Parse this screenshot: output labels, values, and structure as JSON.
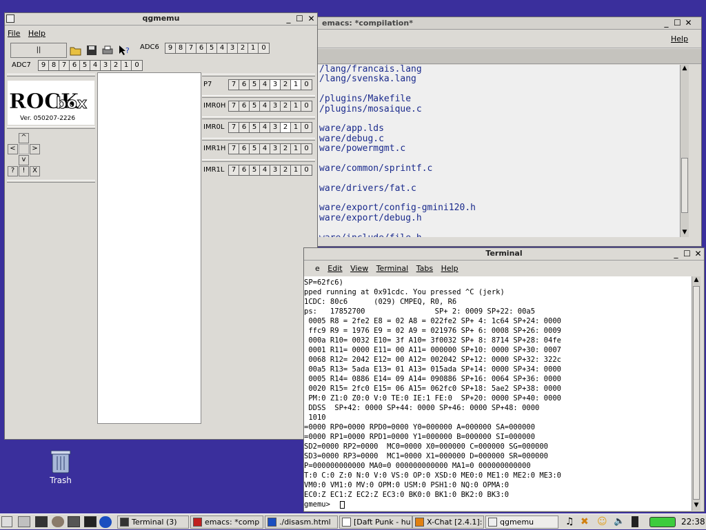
{
  "qgmemu": {
    "title": "qgmemu",
    "menu": [
      "File",
      "Help"
    ],
    "pause_label": "||",
    "adc6_label": "ADC6",
    "adc7_label": "ADC7",
    "adc_bits": [
      "9",
      "8",
      "7",
      "6",
      "5",
      "4",
      "3",
      "2",
      "1",
      "0"
    ],
    "port_bits": [
      "7",
      "6",
      "5",
      "4",
      "3",
      "2",
      "1",
      "0"
    ],
    "ports": [
      "P7",
      "IMR0H",
      "IMR0L",
      "IMR1H",
      "IMR1L"
    ],
    "logo_text": "ROCK",
    "logo_text2": "box",
    "version": "Ver. 050207-2226",
    "dpad": {
      "up": "^",
      "left": "<",
      "right": ">",
      "down": "v",
      "q": "?",
      "bang": "!",
      "x": "X"
    }
  },
  "emacs": {
    "title": "emacs: *compilation*",
    "help": "Help",
    "lines": [
      "/lang/francais.lang",
      "/lang/svenska.lang",
      "",
      "/plugins/Makefile",
      "/plugins/mosaique.c",
      "",
      "ware/app.lds",
      "ware/debug.c",
      "ware/powermgmt.c",
      "",
      "ware/common/sprintf.c",
      "",
      "ware/drivers/fat.c",
      "",
      "ware/export/config-gmini120.h",
      "ware/export/debug.h",
      "",
      "ware/include/file.h"
    ]
  },
  "terminal": {
    "title": "Terminal",
    "menu": [
      "e",
      "Edit",
      "View",
      "Terminal",
      "Tabs",
      "Help"
    ],
    "lines": [
      "SP=62fc6)",
      "pped running at 0x91cdc. You pressed ^C (jerk)",
      "1CDC: 80c6      (029) CMPEQ, R0, R6",
      "ps:   17852700                SP+ 2: 0009 SP+22: 00a5",
      " 0005 R8 = 2fe2 E8 = 02 A8 = 022fe2 SP+ 4: 1c64 SP+24: 0000",
      " ffc9 R9 = 1976 E9 = 02 A9 = 021976 SP+ 6: 0008 SP+26: 0009",
      " 000a R10= 0032 E10= 3f A10= 3f0032 SP+ 8: 8714 SP+28: 04fe",
      " 0001 R11= 0000 E11= 00 A11= 000000 SP+10: 0000 SP+30: 0007",
      " 0068 R12= 2042 E12= 00 A12= 002042 SP+12: 0000 SP+32: 322c",
      " 00a5 R13= 5ada E13= 01 A13= 015ada SP+14: 0000 SP+34: 0000",
      " 0005 R14= 0886 E14= 09 A14= 090886 SP+16: 0064 SP+36: 0000",
      " 0020 R15= 2fc0 E15= 06 A15= 062fc0 SP+18: 5ae2 SP+38: 0000",
      " PM:0 Z1:0 Z0:0 V:0 TE:0 IE:1 FE:0  SP+20: 0000 SP+40: 0000",
      " DDSS  SP+42: 0000 SP+44: 0000 SP+46: 0000 SP+48: 0000",
      " 1010",
      "=0000 RP0=0000 RPD0=0000 Y0=000000 A=000000 SA=000000",
      "=0000 RP1=0000 RPD1=0000 Y1=000000 B=000000 SI=000000",
      "SD2=0000 RP2=0000  MC0=0000 X0=000000 C=000000 SG=000000",
      "SD3=0000 RP3=0000  MC1=0000 X1=000000 D=000000 SR=000000",
      "P=000000000000 MA0=0 000000000000 MA1=0 000000000000",
      "T:0 C:0 Z:0 N:0 V:0 VS:0 OP:0 XSD:0 ME0:0 ME1:0 ME2:0 ME3:0",
      "VM0:0 VM1:0 MV:0 OPM:0 USM:0 PSH1:0 NQ:0 OPMA:0",
      "EC0:Z EC1:Z EC2:Z EC3:0 BK0:0 BK1:0 BK2:0 BK3:0",
      "gmemu> "
    ]
  },
  "desktop": {
    "trash_label": "Trash"
  },
  "taskbar": {
    "tasks": [
      "Terminal (3)",
      "emacs: *comp",
      "./disasm.html",
      "[Daft Punk - hu",
      "X-Chat [2.4.1]:",
      "qgmemu"
    ],
    "clock": "22:38"
  },
  "colors": {
    "desktop": "#3a2f9c",
    "emacs_text": "#1a2a8c",
    "battery": "#3dcc3d"
  }
}
